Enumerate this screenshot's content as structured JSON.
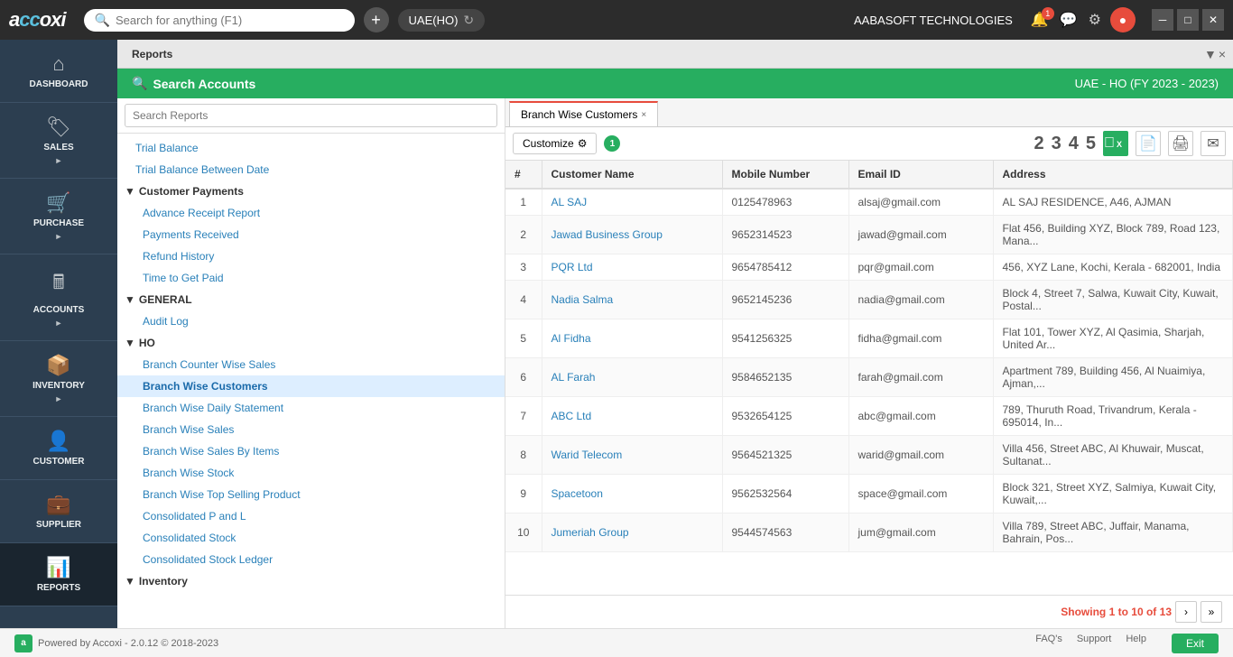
{
  "topbar": {
    "logo": "accoxi",
    "search_placeholder": "Search for anything (F1)",
    "company": "UAE(HO)",
    "company_full": "AABASOFT TECHNOLOGIES",
    "notification_count": "1"
  },
  "reports_tab": {
    "label": "Reports",
    "close": "×",
    "expand": "▼"
  },
  "green_header": {
    "search_label": "Search Accounts",
    "fy_label": "UAE - HO (FY 2023 - 2023)"
  },
  "left_panel": {
    "search_placeholder": "Search Reports",
    "tree": [
      {
        "type": "item",
        "label": "Trial Balance",
        "indent": 1
      },
      {
        "type": "item",
        "label": "Trial Balance Between Date",
        "indent": 1
      },
      {
        "type": "section",
        "label": "Customer Payments",
        "open": true
      },
      {
        "type": "item",
        "label": "Advance Receipt Report",
        "indent": 2
      },
      {
        "type": "item",
        "label": "Payments Received",
        "indent": 2
      },
      {
        "type": "item",
        "label": "Refund History",
        "indent": 2
      },
      {
        "type": "item",
        "label": "Time to Get Paid",
        "indent": 2
      },
      {
        "type": "section",
        "label": "GENERAL",
        "open": true
      },
      {
        "type": "item",
        "label": "Audit Log",
        "indent": 2
      },
      {
        "type": "section",
        "label": "HO",
        "open": true
      },
      {
        "type": "item",
        "label": "Branch Counter Wise Sales",
        "indent": 2
      },
      {
        "type": "item",
        "label": "Branch Wise Customers",
        "indent": 2,
        "active": true
      },
      {
        "type": "item",
        "label": "Branch Wise Daily Statement",
        "indent": 2
      },
      {
        "type": "item",
        "label": "Branch Wise Sales",
        "indent": 2
      },
      {
        "type": "item",
        "label": "Branch Wise Sales By Items",
        "indent": 2
      },
      {
        "type": "item",
        "label": "Branch Wise Stock",
        "indent": 2
      },
      {
        "type": "item",
        "label": "Branch Wise Top Selling Product",
        "indent": 2
      },
      {
        "type": "item",
        "label": "Consolidated P and L",
        "indent": 2
      },
      {
        "type": "item",
        "label": "Consolidated Stock",
        "indent": 2
      },
      {
        "type": "item",
        "label": "Consolidated Stock Ledger",
        "indent": 2
      },
      {
        "type": "section",
        "label": "Inventory",
        "open": true
      }
    ]
  },
  "sub_tab": {
    "label": "Branch Wise Customers",
    "close": "×"
  },
  "toolbar": {
    "customize_label": "Customize",
    "number_badge": "1",
    "nums": [
      "2",
      "3",
      "4",
      "5"
    ]
  },
  "table": {
    "columns": [
      "#",
      "Customer Name",
      "Mobile Number",
      "Email ID",
      "Address"
    ],
    "rows": [
      {
        "num": "1",
        "name": "AL SAJ",
        "mobile": "0125478963",
        "email": "alsaj@gmail.com",
        "address": "AL SAJ RESIDENCE, A46, AJMAN"
      },
      {
        "num": "2",
        "name": "Jawad Business Group",
        "mobile": "9652314523",
        "email": "jawad@gmail.com",
        "address": "Flat 456, Building XYZ, Block 789, Road 123, Mana..."
      },
      {
        "num": "3",
        "name": "PQR Ltd",
        "mobile": "9654785412",
        "email": "pqr@gmail.com",
        "address": "456, XYZ Lane, Kochi, Kerala - 682001, India"
      },
      {
        "num": "4",
        "name": "Nadia Salma",
        "mobile": "9652145236",
        "email": "nadia@gmail.com",
        "address": "Block 4, Street 7, Salwa, Kuwait City, Kuwait, Postal..."
      },
      {
        "num": "5",
        "name": "Al Fidha",
        "mobile": "9541256325",
        "email": "fidha@gmail.com",
        "address": "Flat 101, Tower XYZ, Al Qasimia, Sharjah, United Ar..."
      },
      {
        "num": "6",
        "name": "AL Farah",
        "mobile": "9584652135",
        "email": "farah@gmail.com",
        "address": "Apartment 789, Building 456, Al Nuaimiya, Ajman,..."
      },
      {
        "num": "7",
        "name": "ABC Ltd",
        "mobile": "9532654125",
        "email": "abc@gmail.com",
        "address": "789, Thuruth Road, Trivandrum, Kerala - 695014, In..."
      },
      {
        "num": "8",
        "name": "Warid Telecom",
        "mobile": "9564521325",
        "email": "warid@gmail.com",
        "address": "Villa 456, Street ABC, Al Khuwair, Muscat, Sultanat..."
      },
      {
        "num": "9",
        "name": "Spacetoon",
        "mobile": "9562532564",
        "email": "space@gmail.com",
        "address": "Block 321, Street XYZ, Salmiya, Kuwait City, Kuwait,..."
      },
      {
        "num": "10",
        "name": "Jumeriah Group",
        "mobile": "9544574563",
        "email": "jum@gmail.com",
        "address": "Villa 789, Street ABC, Juffair, Manama, Bahrain, Pos..."
      }
    ]
  },
  "pagination": {
    "showing_prefix": "Showing ",
    "from": "1",
    "to_prefix": " to ",
    "to": "10",
    "of_prefix": " of ",
    "total": "13"
  },
  "sidebar": {
    "items": [
      {
        "id": "dashboard",
        "icon": "⌂",
        "label": "DASHBOARD"
      },
      {
        "id": "sales",
        "icon": "🏷",
        "label": "SALES",
        "arrow": "►"
      },
      {
        "id": "purchase",
        "icon": "🛒",
        "label": "PURCHASE",
        "arrow": "►"
      },
      {
        "id": "accounts",
        "icon": "🖩",
        "label": "ACCOUNTS",
        "arrow": "►"
      },
      {
        "id": "inventory",
        "icon": "📦",
        "label": "INVENTORY",
        "arrow": "►"
      },
      {
        "id": "customer",
        "icon": "👤",
        "label": "CUSTOMER"
      },
      {
        "id": "supplier",
        "icon": "💼",
        "label": "SUPPLIER"
      },
      {
        "id": "reports",
        "icon": "📊",
        "label": "REPORTS",
        "active": true
      }
    ]
  },
  "bottom_bar": {
    "powered": "Powered by Accoxi - 2.0.12 © 2018-2023",
    "faqs": "FAQ's",
    "support": "Support",
    "help": "Help",
    "exit": "Exit"
  }
}
